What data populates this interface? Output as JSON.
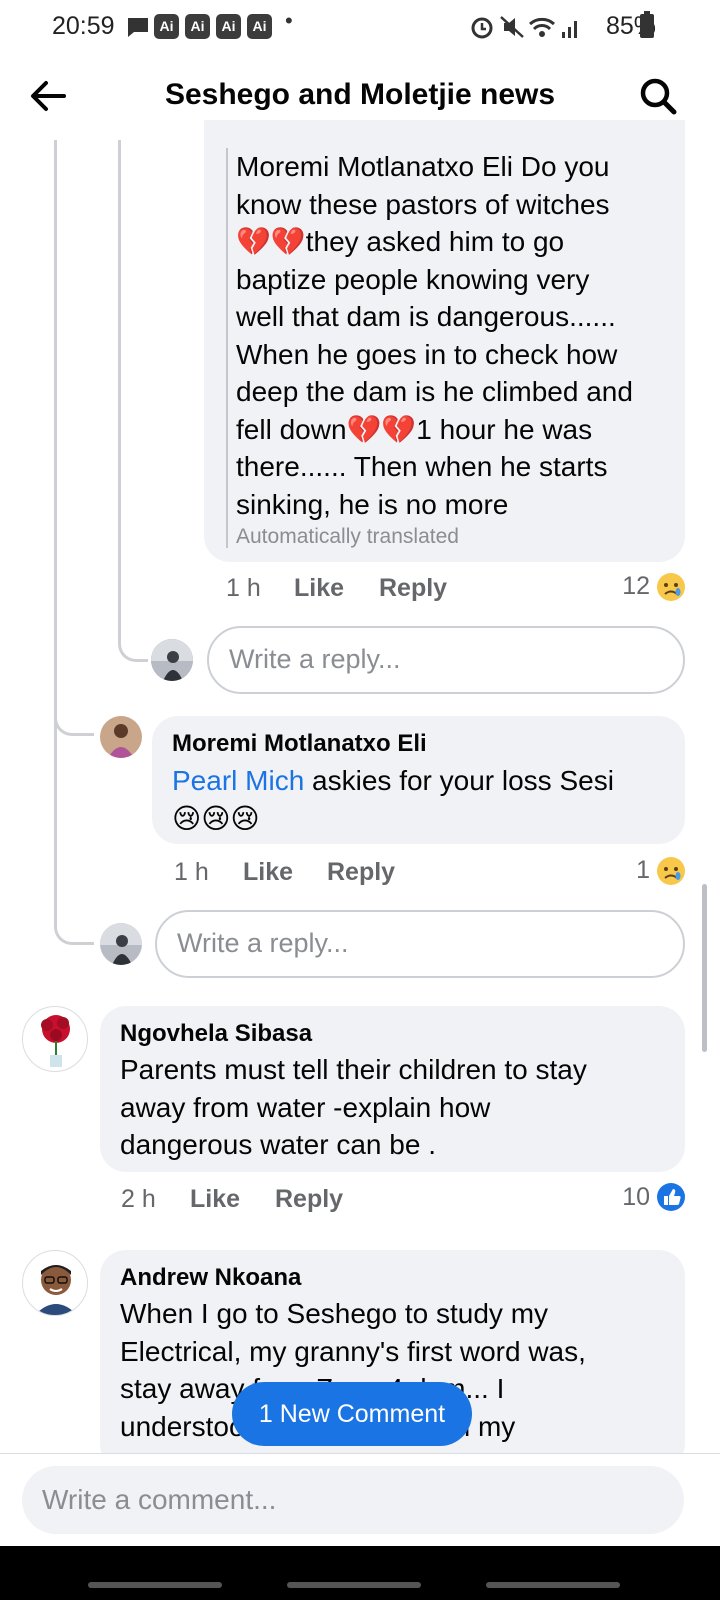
{
  "status_bar": {
    "time": "20:59",
    "ai_badge": "Ai",
    "battery": "85%"
  },
  "header": {
    "title": "Seshego and Moletjie news"
  },
  "thread": [
    {
      "text": "Moremi Motlanatxo Eli Do you know these pastors of witches 💔💔they asked him to go baptize people knowing very well that dam is dangerous...... When he goes in to check how deep the dam is he climbed and fell down💔💔1 hour he was there...... Then when he starts sinking, he is no more",
      "lines": [
        "Moremi Motlanatxo Eli Do you",
        "know these pastors of witches",
        "💔💔they asked him to go",
        "baptize people knowing very",
        "well that dam is dangerous......",
        "When he goes in to check how",
        "deep the dam is he climbed and",
        "fell down💔💔1 hour he was",
        "there...... Then when he starts",
        "sinking, he is no more"
      ],
      "translation_note": "Automatically translated",
      "time": "1 h",
      "like": "Like",
      "reply": "Reply",
      "reaction_count": "12",
      "reaction_icon": "sad-emoji"
    },
    {
      "author": "Moremi Motlanatxo Eli",
      "mention": "Pearl Mich",
      "text": " askies for your loss Sesi",
      "emoji_line": "😢😢😢",
      "time": "1 h",
      "like": "Like",
      "reply": "Reply",
      "reaction_count": "1",
      "reaction_icon": "sad-emoji"
    },
    {
      "author": "Ngovhela Sibasa",
      "lines": [
        "Parents must tell their children  to stay",
        "away from water -explain  how",
        "dangerous  water can be ."
      ],
      "time": "2 h",
      "like": "Like",
      "reply": "Reply",
      "reaction_count": "10",
      "reaction_icon": "like-thumb"
    },
    {
      "author": "Andrew Nkoana",
      "lines": [
        "When I go to Seshego to study my",
        "Electrical, my granny's first word was,",
        "stay away from Zone 4 dam... I",
        "understood her comment on my"
      ]
    }
  ],
  "reply_placeholder": "Write a reply...",
  "new_comment_pill": "1 New Comment",
  "composer_placeholder": "Write a comment...",
  "colors": {
    "accent": "#1b74e4",
    "bubble": "#f0f2f5",
    "muted_text": "#65676b"
  }
}
